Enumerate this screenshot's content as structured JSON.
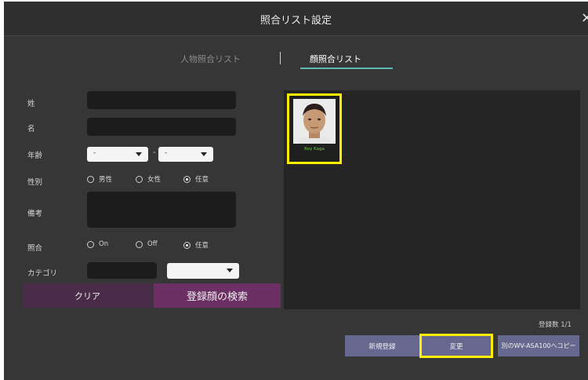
{
  "window": {
    "title": "照合リスト設定",
    "close_label": "×"
  },
  "tabs": [
    {
      "label": "人物照合リスト",
      "active": false
    },
    {
      "label": "顔照合リスト",
      "active": true
    }
  ],
  "form": {
    "last_name_label": "姓",
    "first_name_label": "名",
    "age_label": "年齢",
    "age_from_value": "-",
    "age_to_value": "-",
    "age_separator": "-",
    "gender_label": "性別",
    "gender_options": [
      "男性",
      "女性",
      "任意"
    ],
    "gender_selected": "任意",
    "note_label": "備考",
    "match_label": "照合",
    "match_options": [
      "On",
      "Off",
      "任意"
    ],
    "match_selected": "任意",
    "category_label": "カテゴリ"
  },
  "buttons": {
    "clear": "クリア",
    "search": "登録顔の検索"
  },
  "faces": [
    {
      "name": "Roy Kaga"
    }
  ],
  "registered_count": "登録数 1/1",
  "actions": {
    "new_register": "新規登録",
    "change": "変更",
    "copy": "別のWV-ASA100へコピー"
  },
  "colors": {
    "accent": "#5fb8ad",
    "highlight": "#ffee00",
    "search_button": "#6b2f64",
    "action_button": "#67688f"
  }
}
